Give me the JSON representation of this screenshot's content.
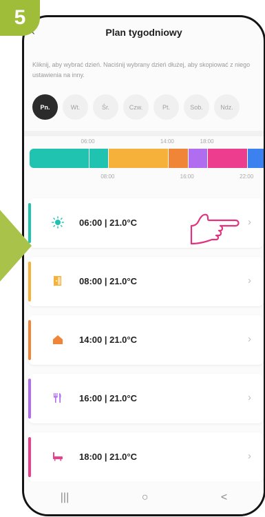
{
  "step_number": "5",
  "header": {
    "title": "Plan tygodniowy"
  },
  "hint": "Kliknij, aby wybrać dzień. Naciśnij wybrany dzień dłużej, aby skopiować z niego ustawienia na inny.",
  "days": [
    {
      "label": "Pn.",
      "active": true
    },
    {
      "label": "Wt."
    },
    {
      "label": "Śr."
    },
    {
      "label": "Czw."
    },
    {
      "label": "Pt."
    },
    {
      "label": "Sob."
    },
    {
      "label": "Ndz."
    }
  ],
  "timeline": {
    "top_labels": [
      "06:00",
      "14:00",
      "18:00"
    ],
    "bottom_labels": [
      "08:00",
      "16:00",
      "22:00"
    ],
    "segments": [
      {
        "start": "00:00",
        "end": "06:00",
        "color": "#1fc3b0"
      },
      {
        "start": "06:00",
        "end": "08:00",
        "color": "#1fc3b0"
      },
      {
        "start": "08:00",
        "end": "14:00",
        "color": "#f6b13a"
      },
      {
        "start": "14:00",
        "end": "16:00",
        "color": "#f08437"
      },
      {
        "start": "16:00",
        "end": "18:00",
        "color": "#b06df0"
      },
      {
        "start": "18:00",
        "end": "22:00",
        "color": "#ec3d8f"
      },
      {
        "start": "22:00",
        "end": "24:00",
        "color": "#3b82f0"
      }
    ]
  },
  "schedule": [
    {
      "time": "06:00",
      "temp": "21.0°C",
      "icon": "sun-icon",
      "color": "#1fc3b0"
    },
    {
      "time": "08:00",
      "temp": "21.0°C",
      "icon": "door-icon",
      "color": "#f6b13a"
    },
    {
      "time": "14:00",
      "temp": "21.0°C",
      "icon": "home-icon",
      "color": "#f08437"
    },
    {
      "time": "16:00",
      "temp": "21.0°C",
      "icon": "fork-knife-icon",
      "color": "#b06df0"
    },
    {
      "time": "18:00",
      "temp": "21.0°C",
      "icon": "bathtub-icon",
      "color": "#ec3d8f"
    }
  ],
  "navbar": {
    "recent": "|||",
    "home": "○",
    "back": "<"
  }
}
